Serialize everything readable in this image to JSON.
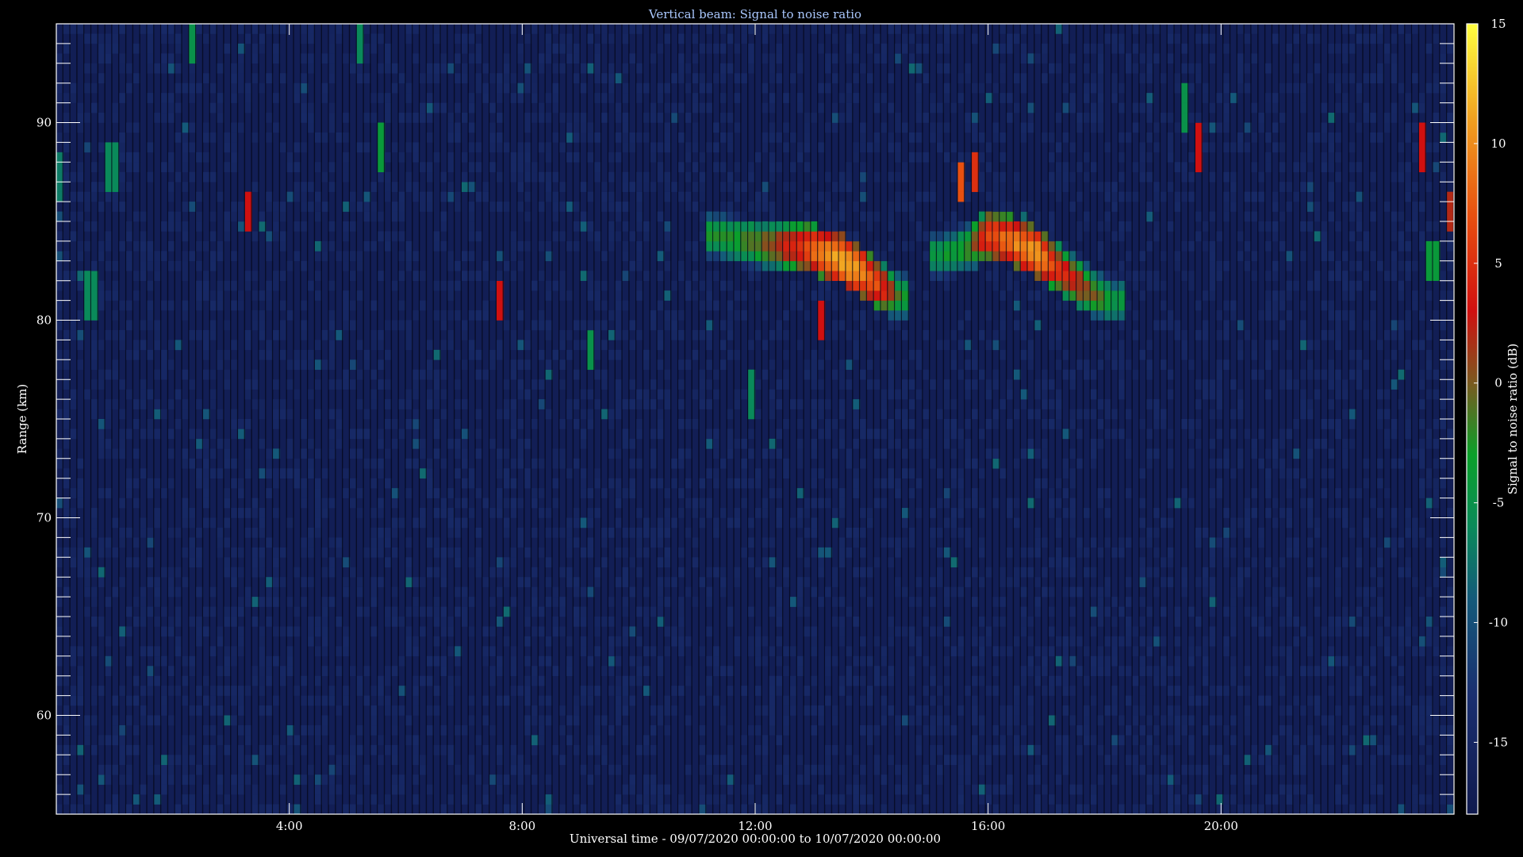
{
  "chart_data": {
    "type": "heatmap",
    "title": "Vertical beam: Signal to noise ratio",
    "xlabel": "Universal time - 09/07/2020 00:00:00 to 10/07/2020 00:00:00",
    "ylabel": "Range (km)",
    "colorbar_label": "Signal to noise ratio (dB)",
    "x_unit": "hours UT",
    "xlim": [
      0,
      24
    ],
    "ylim": [
      55,
      95
    ],
    "zlim": [
      -18,
      15
    ],
    "x_ticks": [
      {
        "value": 4,
        "label": "4:00"
      },
      {
        "value": 8,
        "label": "8:00"
      },
      {
        "value": 12,
        "label": "12:00"
      },
      {
        "value": 16,
        "label": "16:00"
      },
      {
        "value": 20,
        "label": "20:00"
      }
    ],
    "y_ticks": [
      {
        "value": 60,
        "label": "60"
      },
      {
        "value": 70,
        "label": "70"
      },
      {
        "value": 80,
        "label": "80"
      },
      {
        "value": 90,
        "label": "90"
      }
    ],
    "y_minor_step_km": 1,
    "colorbar_ticks": [
      {
        "value": 15,
        "label": "15"
      },
      {
        "value": 10,
        "label": "10"
      },
      {
        "value": 5,
        "label": "5"
      },
      {
        "value": 0,
        "label": "0"
      },
      {
        "value": -5,
        "label": "-5"
      },
      {
        "value": -10,
        "label": "-10"
      },
      {
        "value": -15,
        "label": "-15"
      }
    ],
    "colormap": [
      {
        "value": -18,
        "color": "#101a4e"
      },
      {
        "value": -13,
        "color": "#1a2f70"
      },
      {
        "value": -9,
        "color": "#145a7a"
      },
      {
        "value": -6,
        "color": "#0a8a5a"
      },
      {
        "value": -3,
        "color": "#0aa02a"
      },
      {
        "value": 0,
        "color": "#7a5a20"
      },
      {
        "value": 3,
        "color": "#d01010"
      },
      {
        "value": 7,
        "color": "#e85010"
      },
      {
        "value": 11,
        "color": "#f0a020"
      },
      {
        "value": 15,
        "color": "#ffff40"
      }
    ],
    "background_snr_db": -17,
    "time_resolution_h": 0.12,
    "range_resolution_km": 0.5,
    "echo_layers": [
      {
        "points": [
          {
            "t": 11.3,
            "h": 84.3,
            "snr": -3
          },
          {
            "t": 11.8,
            "h": 84.0,
            "snr": -2
          },
          {
            "t": 12.3,
            "h": 83.8,
            "snr": 1
          },
          {
            "t": 12.8,
            "h": 83.7,
            "snr": 6
          },
          {
            "t": 13.2,
            "h": 83.4,
            "snr": 10
          },
          {
            "t": 13.6,
            "h": 82.9,
            "snr": 12
          },
          {
            "t": 13.9,
            "h": 82.3,
            "snr": 9
          },
          {
            "t": 14.2,
            "h": 81.6,
            "snr": 5
          },
          {
            "t": 14.5,
            "h": 81.2,
            "snr": -3
          }
        ],
        "thickness_km": 2.5
      },
      {
        "points": [
          {
            "t": 15.2,
            "h": 83.3,
            "snr": -4
          },
          {
            "t": 15.6,
            "h": 83.6,
            "snr": -2
          },
          {
            "t": 16.0,
            "h": 84.3,
            "snr": 6
          },
          {
            "t": 16.4,
            "h": 84.0,
            "snr": 9
          },
          {
            "t": 16.8,
            "h": 83.5,
            "snr": 11
          },
          {
            "t": 17.2,
            "h": 82.6,
            "snr": 5
          },
          {
            "t": 17.6,
            "h": 81.8,
            "snr": 2
          },
          {
            "t": 17.9,
            "h": 81.2,
            "snr": -1
          },
          {
            "t": 18.2,
            "h": 81.0,
            "snr": -4
          }
        ],
        "thickness_km": 2.5
      }
    ],
    "isolated_echoes": [
      {
        "t": 0.1,
        "h": 87.2,
        "snr": -7
      },
      {
        "t": 0.6,
        "h": 81.2,
        "snr": -6
      },
      {
        "t": 0.95,
        "h": 87.8,
        "snr": -6
      },
      {
        "t": 2.3,
        "h": 94.0,
        "snr": -5
      },
      {
        "t": 3.3,
        "h": 85.5,
        "snr": 3
      },
      {
        "t": 5.2,
        "h": 94.2,
        "snr": -6
      },
      {
        "t": 5.6,
        "h": 88.6,
        "snr": -4
      },
      {
        "t": 7.65,
        "h": 81.0,
        "snr": 3
      },
      {
        "t": 9.2,
        "h": 78.5,
        "snr": -5
      },
      {
        "t": 11.9,
        "h": 76.3,
        "snr": -6
      },
      {
        "t": 13.15,
        "h": 80.0,
        "snr": 3
      },
      {
        "t": 15.5,
        "h": 87.0,
        "snr": 7
      },
      {
        "t": 15.75,
        "h": 87.5,
        "snr": 5
      },
      {
        "t": 19.35,
        "h": 90.7,
        "snr": -5
      },
      {
        "t": 19.65,
        "h": 88.7,
        "snr": 3
      },
      {
        "t": 23.5,
        "h": 88.8,
        "snr": 3
      },
      {
        "t": 23.65,
        "h": 83.0,
        "snr": -4
      },
      {
        "t": 23.9,
        "h": 85.5,
        "snr": 2
      }
    ]
  }
}
